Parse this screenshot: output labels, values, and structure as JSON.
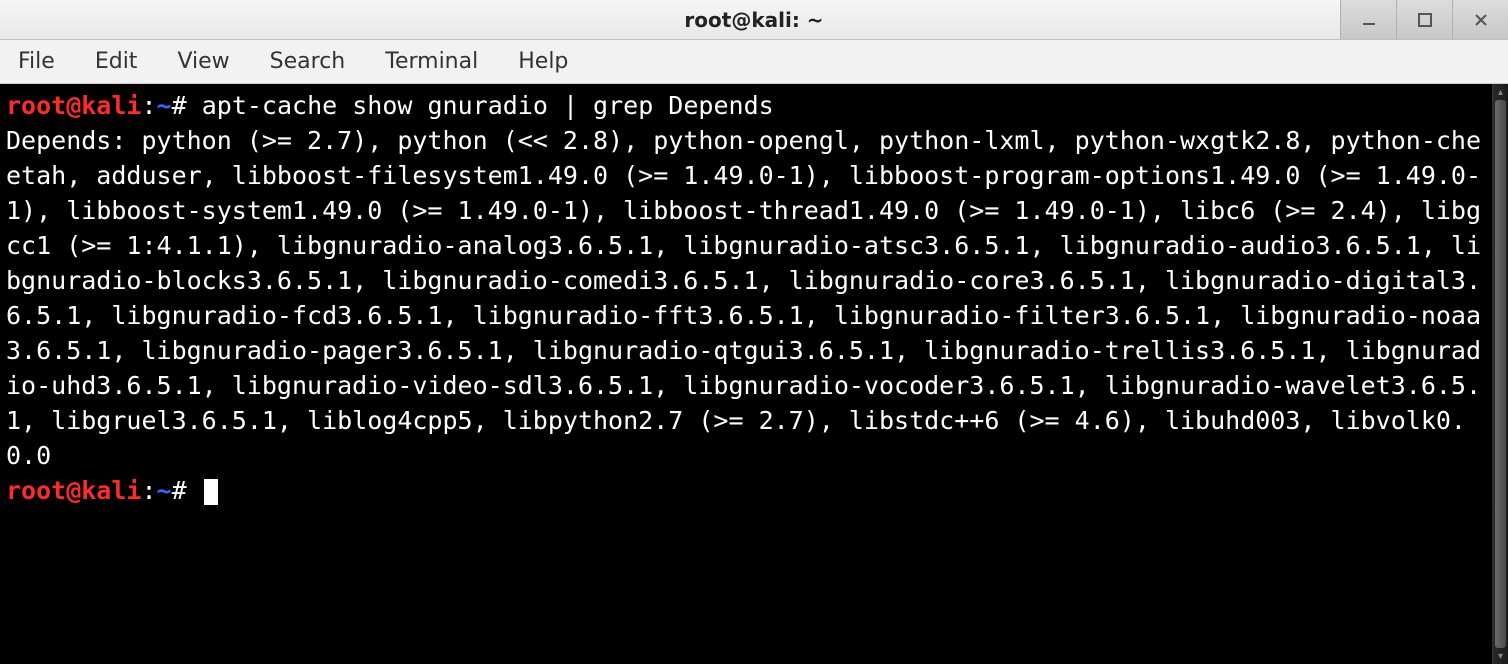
{
  "window": {
    "title": "root@kali: ~"
  },
  "menu": {
    "items": [
      "File",
      "Edit",
      "View",
      "Search",
      "Terminal",
      "Help"
    ]
  },
  "terminal": {
    "prompts": [
      {
        "user": "root@kali",
        "sep1": ":",
        "path": "~",
        "sep2": "#",
        "command": "apt-cache show gnuradio | grep Depends"
      },
      {
        "user": "root@kali",
        "sep1": ":",
        "path": "~",
        "sep2": "#",
        "command": ""
      }
    ],
    "output": "Depends: python (>= 2.7), python (<< 2.8), python-opengl, python-lxml, python-wxgtk2.8, python-cheetah, adduser, libboost-filesystem1.49.0 (>= 1.49.0-1), libboost-program-options1.49.0 (>= 1.49.0-1), libboost-system1.49.0 (>= 1.49.0-1), libboost-thread1.49.0 (>= 1.49.0-1), libc6 (>= 2.4), libgcc1 (>= 1:4.1.1), libgnuradio-analog3.6.5.1, libgnuradio-atsc3.6.5.1, libgnuradio-audio3.6.5.1, libgnuradio-blocks3.6.5.1, libgnuradio-comedi3.6.5.1, libgnuradio-core3.6.5.1, libgnuradio-digital3.6.5.1, libgnuradio-fcd3.6.5.1, libgnuradio-fft3.6.5.1, libgnuradio-filter3.6.5.1, libgnuradio-noaa3.6.5.1, libgnuradio-pager3.6.5.1, libgnuradio-qtgui3.6.5.1, libgnuradio-trellis3.6.5.1, libgnuradio-uhd3.6.5.1, libgnuradio-video-sdl3.6.5.1, libgnuradio-vocoder3.6.5.1, libgnuradio-wavelet3.6.5.1, libgruel3.6.5.1, liblog4cpp5, libpython2.7 (>= 2.7), libstdc++6 (>= 4.6), libuhd003, libvolk0.0.0"
  }
}
